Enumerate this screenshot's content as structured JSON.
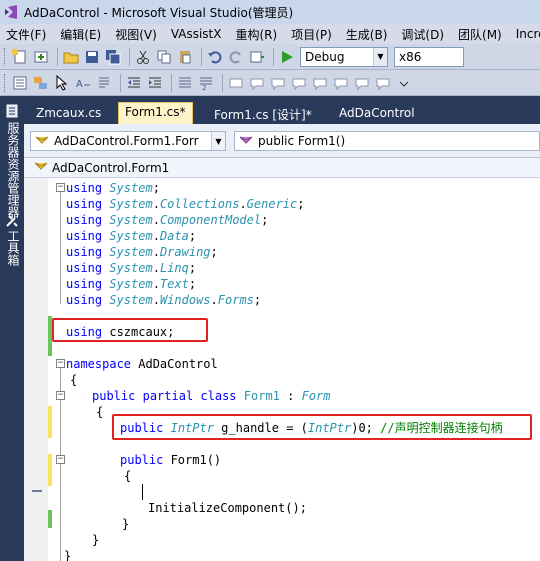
{
  "window": {
    "title": "AdDaControl - Microsoft Visual Studio(管理员)"
  },
  "menu": [
    "文件(F)",
    "编辑(E)",
    "视图(V)",
    "VAssistX",
    "重构(R)",
    "项目(P)",
    "生成(B)",
    "调试(D)",
    "团队(M)",
    "Incred"
  ],
  "toolbar": {
    "config": "Debug",
    "platform": "x86"
  },
  "sidebar": {
    "server_explorer": "服务器资源管理器",
    "toolbox": "工具箱"
  },
  "tabs": [
    "Zmcaux.cs",
    "Form1.cs*",
    "Form1.cs [设计]*",
    "AdDaControl"
  ],
  "nav": {
    "left": "AdDaControl.Form1.Forr",
    "right": "public Form1()"
  },
  "classbar": "AdDaControl.Form1",
  "code": {
    "usings": [
      "using System;",
      "using System.Collections.Generic;",
      "using System.ComponentModel;",
      "using System.Data;",
      "using System.Drawing;",
      "using System.Linq;",
      "using System.Text;",
      "using System.Windows.Forms;"
    ],
    "using_custom": "using cszmcaux;",
    "namespace": "namespace AdDaControl",
    "open_ns": "{",
    "class_decl": "public partial class Form1 : Form",
    "open_cls": "{",
    "field": "public IntPtr g_handle = (IntPtr)0; //声明控制器连接句柄",
    "ctor": "public Form1()",
    "open_ctor": "{",
    "call": "InitializeComponent();",
    "close_ctor": "}",
    "close_cls": "}",
    "close_ns": "}"
  },
  "colors": {
    "keyword": "#0000ff",
    "type": "#2b91af",
    "comment": "#008000",
    "highlight_box": "#e02222"
  }
}
